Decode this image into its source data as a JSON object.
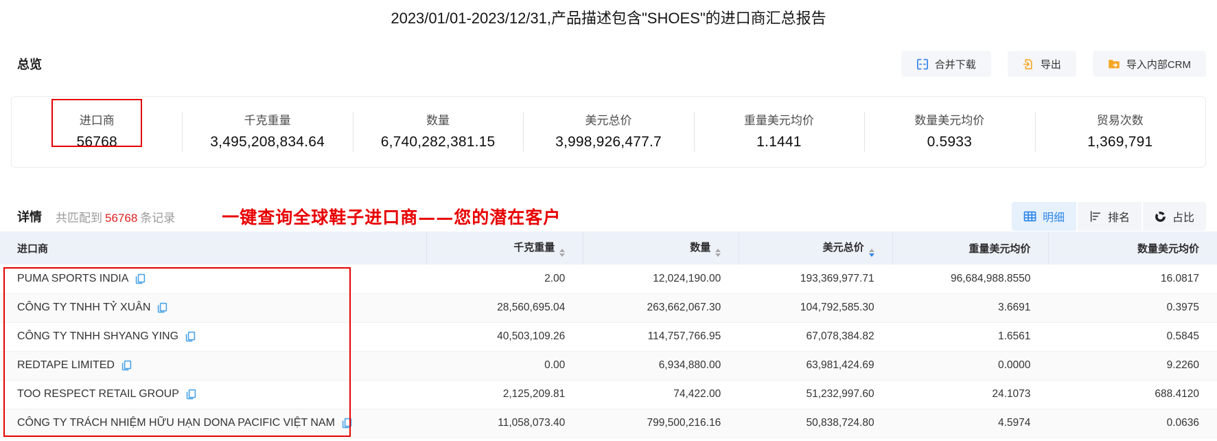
{
  "title": "2023/01/01-2023/12/31,产品描述包含\"SHOES\"的进口商汇总报告",
  "overview": {
    "heading": "总览",
    "buttons": [
      {
        "label": "合并下载",
        "icon": "merge-download-icon",
        "name": "merge-download-button"
      },
      {
        "label": "导出",
        "icon": "export-icon",
        "name": "export-button"
      },
      {
        "label": "导入内部CRM",
        "icon": "import-crm-icon",
        "name": "import-crm-button"
      }
    ],
    "stats": [
      {
        "label": "进口商",
        "value": "56768",
        "highlighted": true
      },
      {
        "label": "千克重量",
        "value": "3,495,208,834.64"
      },
      {
        "label": "数量",
        "value": "6,740,282,381.15"
      },
      {
        "label": "美元总价",
        "value": "3,998,926,477.7"
      },
      {
        "label": "重量美元均价",
        "value": "1.1441"
      },
      {
        "label": "数量美元均价",
        "value": "0.5933"
      },
      {
        "label": "贸易次数",
        "value": "1,369,791"
      }
    ]
  },
  "details": {
    "heading": "详情",
    "match_prefix": "共匹配到",
    "match_count": "56768",
    "match_suffix": "条记录",
    "annotation": "一键查询全球鞋子进口商——您的潜在客户",
    "tabs": [
      {
        "label": "明细",
        "icon": "table-icon",
        "name": "tab-detail",
        "active": true
      },
      {
        "label": "排名",
        "icon": "ranking-icon",
        "name": "tab-ranking",
        "active": false
      },
      {
        "label": "占比",
        "icon": "pie-icon",
        "name": "tab-proportion",
        "active": false
      }
    ]
  },
  "table": {
    "columns": [
      {
        "label": "进口商",
        "sortable": false,
        "sorted": ""
      },
      {
        "label": "千克重量",
        "sortable": true,
        "sorted": ""
      },
      {
        "label": "数量",
        "sortable": true,
        "sorted": ""
      },
      {
        "label": "美元总价",
        "sortable": true,
        "sorted": "desc"
      },
      {
        "label": "重量美元均价",
        "sortable": false,
        "sorted": ""
      },
      {
        "label": "数量美元均价",
        "sortable": false,
        "sorted": ""
      }
    ],
    "rows": [
      {
        "importer": "PUMA SPORTS INDIA",
        "kg": "2.00",
        "qty": "12,024,190.00",
        "usd": "193,369,977.71",
        "usd_per_kg": "96,684,988.8550",
        "usd_per_qty": "16.0817"
      },
      {
        "importer": "CÔNG TY TNHH TỶ XUÂN",
        "kg": "28,560,695.04",
        "qty": "263,662,067.30",
        "usd": "104,792,585.30",
        "usd_per_kg": "3.6691",
        "usd_per_qty": "0.3975"
      },
      {
        "importer": "CÔNG TY TNHH SHYANG YING",
        "kg": "40,503,109.26",
        "qty": "114,757,766.95",
        "usd": "67,078,384.82",
        "usd_per_kg": "1.6561",
        "usd_per_qty": "0.5845"
      },
      {
        "importer": "REDTAPE LIMITED",
        "kg": "0.00",
        "qty": "6,934,880.00",
        "usd": "63,981,424.69",
        "usd_per_kg": "0.0000",
        "usd_per_qty": "9.2260"
      },
      {
        "importer": "TOO RESPECT RETAIL GROUP",
        "kg": "2,125,209.81",
        "qty": "74,422.00",
        "usd": "51,232,997.60",
        "usd_per_kg": "24.1073",
        "usd_per_qty": "688.4120"
      },
      {
        "importer": "CÔNG TY TRÁCH NHIỆM HỮU HẠN DONA PACIFIC VIỆT NAM",
        "kg": "11,058,073.40",
        "qty": "799,500,216.16",
        "usd": "50,838,724.80",
        "usd_per_kg": "4.5974",
        "usd_per_qty": "0.0636"
      }
    ]
  },
  "colors": {
    "accent_blue": "#2f86e8",
    "icon_orange": "#f5a623",
    "annotation_red": "#e60000",
    "count_red": "#e02020",
    "table_header_bg": "#edf1f8",
    "button_bg": "#f5f6f9",
    "active_tab_bg": "#e6f1fc"
  }
}
